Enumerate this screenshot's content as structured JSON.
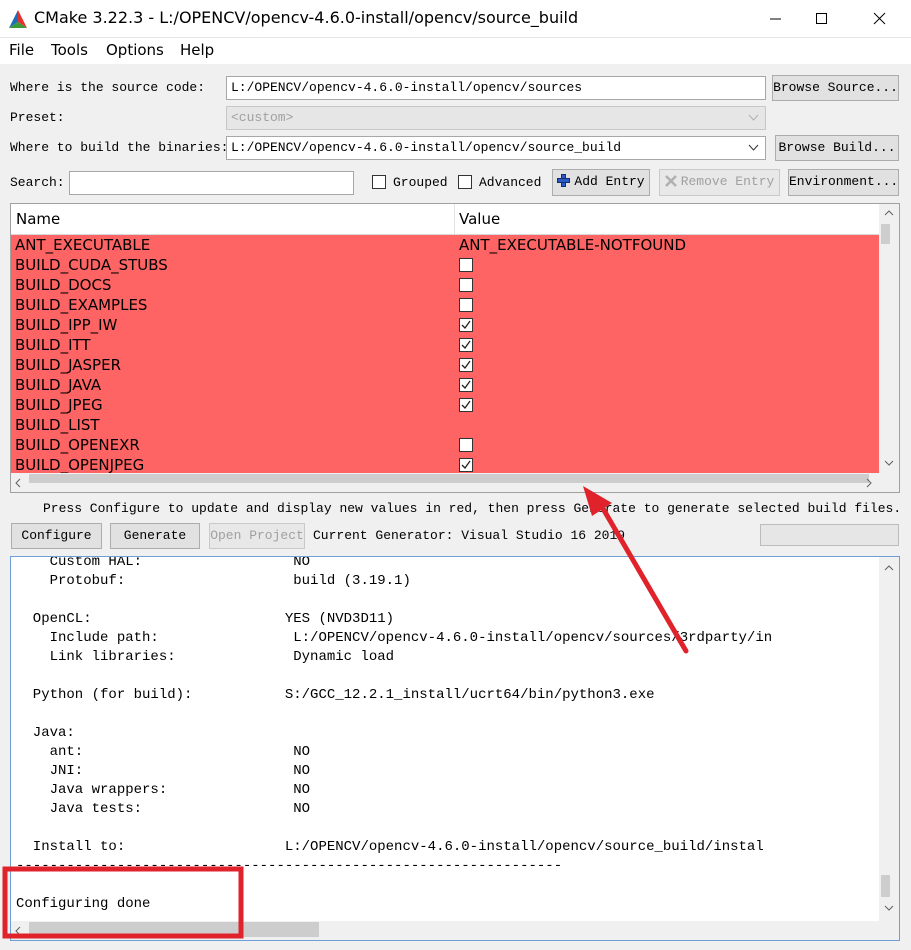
{
  "window": {
    "title": "CMake 3.22.3 - L:/OPENCV/opencv-4.6.0-install/opencv/source_build"
  },
  "menu": [
    "File",
    "Tools",
    "Options",
    "Help"
  ],
  "source": {
    "label": "Where is the source code:",
    "value": "L:/OPENCV/opencv-4.6.0-install/opencv/sources",
    "button": "Browse Source..."
  },
  "preset": {
    "label": "Preset:",
    "value": "<custom>"
  },
  "build": {
    "label": "Where to build the binaries:",
    "value": "L:/OPENCV/opencv-4.6.0-install/opencv/source_build",
    "button": "Browse Build..."
  },
  "search": {
    "label": "Search:",
    "value": "",
    "grouped_label": "Grouped",
    "advanced_label": "Advanced",
    "add_entry": "Add Entry",
    "remove_entry": "Remove Entry",
    "environment": "Environment..."
  },
  "table": {
    "headers": [
      "Name",
      "Value"
    ],
    "rows": [
      {
        "name": "ANT_EXECUTABLE",
        "value": "ANT_EXECUTABLE-NOTFOUND"
      },
      {
        "name": "BUILD_CUDA_STUBS",
        "checked": false
      },
      {
        "name": "BUILD_DOCS",
        "checked": false
      },
      {
        "name": "BUILD_EXAMPLES",
        "checked": false
      },
      {
        "name": "BUILD_IPP_IW",
        "checked": true
      },
      {
        "name": "BUILD_ITT",
        "checked": true
      },
      {
        "name": "BUILD_JASPER",
        "checked": true
      },
      {
        "name": "BUILD_JAVA",
        "checked": true
      },
      {
        "name": "BUILD_JPEG",
        "checked": true
      },
      {
        "name": "BUILD_LIST",
        "value": ""
      },
      {
        "name": "BUILD_OPENEXR",
        "checked": false
      },
      {
        "name": "BUILD_OPENJPEG",
        "checked": true
      }
    ]
  },
  "hint": "Press Configure to update and display new values in red, then press Generate to generate selected build files.",
  "actions": {
    "configure": "Configure",
    "generate": "Generate",
    "open_project": "Open Project",
    "generator": "Current Generator: Visual Studio 16 2019"
  },
  "log": [
    "    Custom HAL:                  NO",
    "    Protobuf:                    build (3.19.1)",
    "",
    "  OpenCL:                       YES (NVD3D11)",
    "    Include path:                L:/OPENCV/opencv-4.6.0-install/opencv/sources/3rdparty/in",
    "    Link libraries:              Dynamic load",
    "",
    "  Python (for build):           S:/GCC_12.2.1_install/ucrt64/bin/python3.exe",
    "",
    "  Java:",
    "    ant:                         NO",
    "    JNI:                         NO",
    "    Java wrappers:               NO",
    "    Java tests:                  NO",
    "",
    "  Install to:                   L:/OPENCV/opencv-4.6.0-install/opencv/source_build/instal",
    "-----------------------------------------------------------------",
    "",
    "Configuring done"
  ],
  "colors": {
    "changed_row": "#ff6464",
    "annotation": "#e0222b",
    "log_border": "#6f9fd8"
  }
}
